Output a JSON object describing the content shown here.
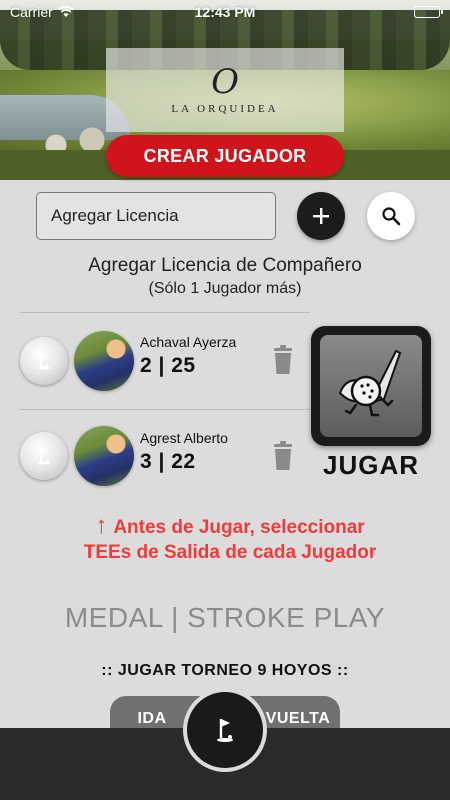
{
  "status_bar": {
    "carrier": "Carrier",
    "time": "12:43 PM"
  },
  "header": {
    "logo_mark": "O",
    "logo_text": "LA ORQUIDEA",
    "create_player_label": "CREAR JUGADOR"
  },
  "license": {
    "input_value": "Agregar Licencia",
    "add_icon": "plus-icon",
    "search_icon": "search-icon"
  },
  "partner": {
    "title": "Agregar Licencia de Compañero",
    "subtitle": "(Sólo 1 Jugador más)"
  },
  "players": [
    {
      "name": "Achaval Ayerza",
      "hcp": "2 | 25"
    },
    {
      "name": "Agrest Alberto",
      "hcp": "3 | 22"
    }
  ],
  "play": {
    "label": "JUGAR",
    "icon": "golf-ball-club-icon"
  },
  "warning": {
    "line1": "Antes de Jugar, seleccionar",
    "line2": "TEEs de Salida de cada Jugador",
    "color": "#ef3b3b"
  },
  "mode": {
    "label": "MEDAL | STROKE PLAY"
  },
  "tournament": {
    "label": ":: JUGAR TORNEO 9 HOYOS ::",
    "left_button": "IDA",
    "right_button": "VUELTA"
  },
  "colors": {
    "accent_red": "#d0141b",
    "background": "#dcdcdc",
    "bottom_bar": "#2a2a2a"
  }
}
